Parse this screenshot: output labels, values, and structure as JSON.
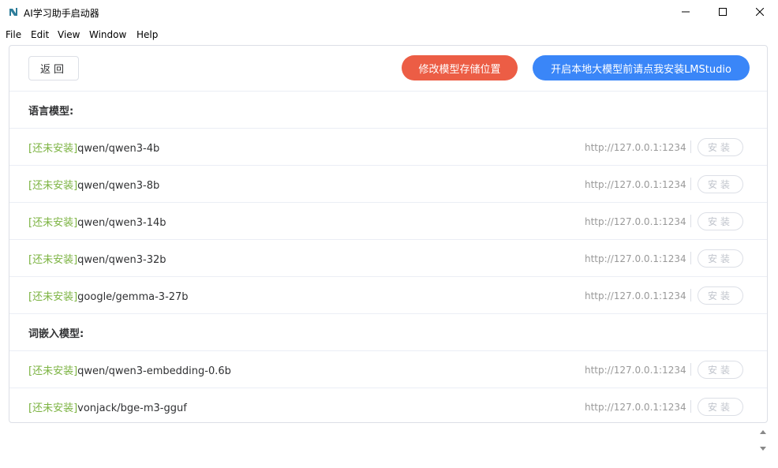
{
  "window": {
    "title": "AI学习助手启动器"
  },
  "menu": [
    "File",
    "Edit",
    "View",
    "Window",
    "Help"
  ],
  "toolbar": {
    "back_label": "返回",
    "change_location_label": "修改模型存储位置",
    "install_lmstudio_label": "开启本地大模型前请点我安装LMStudio"
  },
  "sections": [
    {
      "title": "语言模型:",
      "models": [
        {
          "status": "[还未安装]",
          "name": "qwen/qwen3-4b",
          "url": "http://127.0.0.1:1234",
          "action": "安装"
        },
        {
          "status": "[还未安装]",
          "name": "qwen/qwen3-8b",
          "url": "http://127.0.0.1:1234",
          "action": "安装"
        },
        {
          "status": "[还未安装]",
          "name": "qwen/qwen3-14b",
          "url": "http://127.0.0.1:1234",
          "action": "安装"
        },
        {
          "status": "[还未安装]",
          "name": "qwen/qwen3-32b",
          "url": "http://127.0.0.1:1234",
          "action": "安装"
        },
        {
          "status": "[还未安装]",
          "name": "google/gemma-3-27b",
          "url": "http://127.0.0.1:1234",
          "action": "安装"
        }
      ]
    },
    {
      "title": "词嵌入模型:",
      "models": [
        {
          "status": "[还未安装]",
          "name": "qwen/qwen3-embedding-0.6b",
          "url": "http://127.0.0.1:1234",
          "action": "安装"
        },
        {
          "status": "[还未安装]",
          "name": "vonjack/bge-m3-gguf",
          "url": "http://127.0.0.1:1234",
          "action": "安装"
        }
      ]
    }
  ],
  "colors": {
    "accent_red": "#ec5d45",
    "accent_blue": "#3a86f8",
    "status_green": "#7cb342"
  }
}
